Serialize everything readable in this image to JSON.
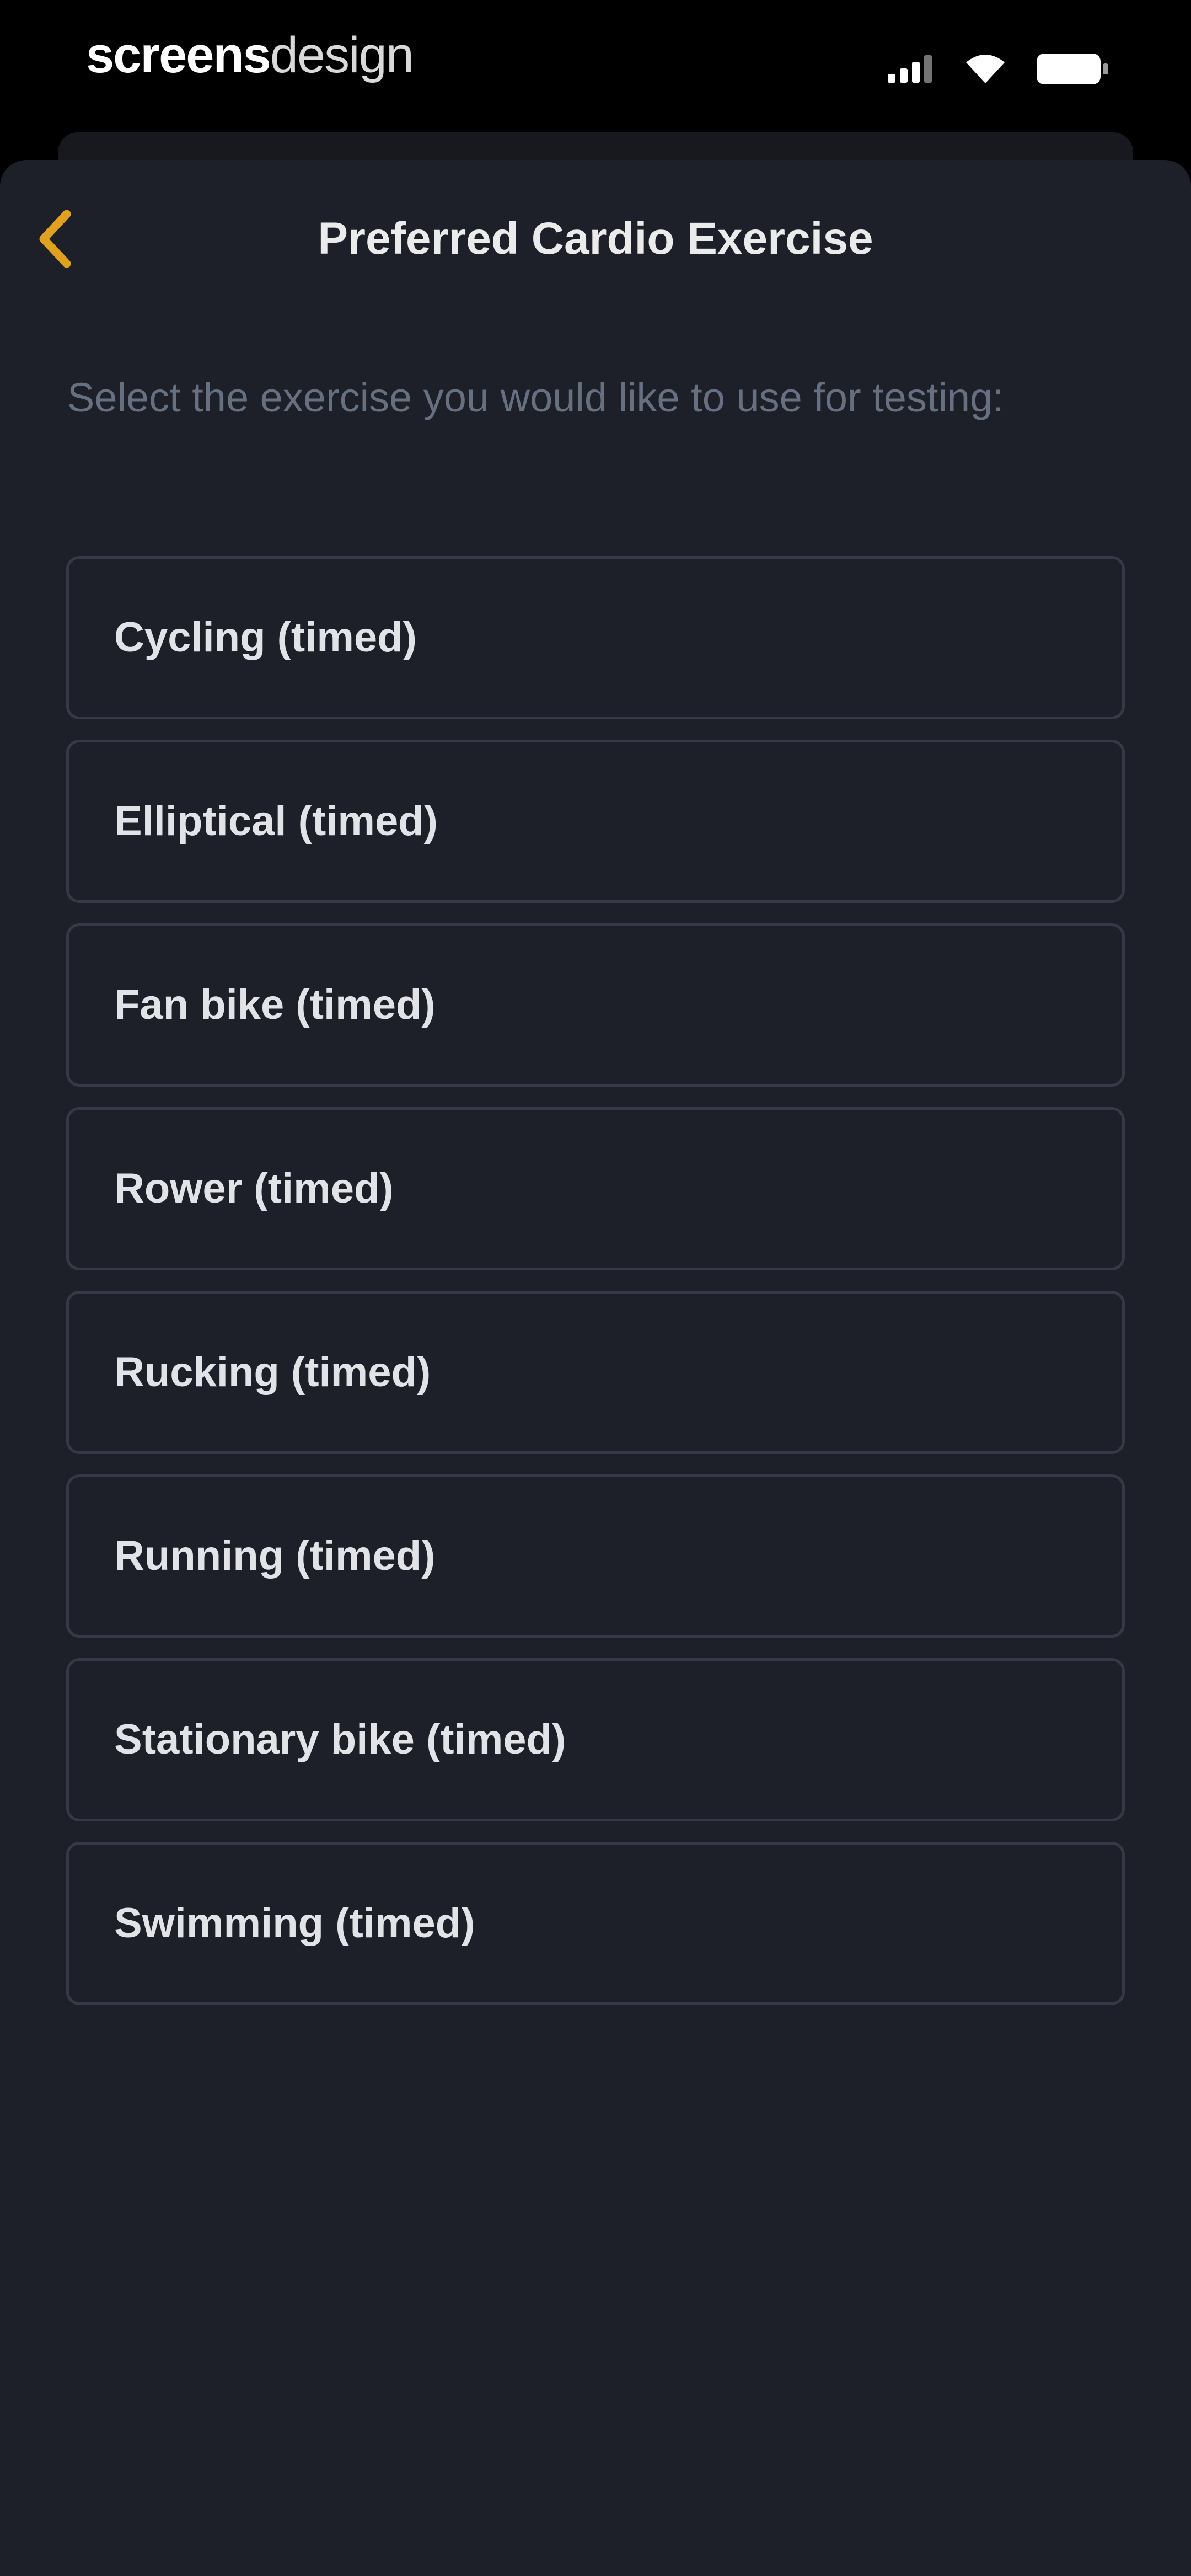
{
  "status_bar": {
    "brand_bold": "screens",
    "brand_light": "design",
    "icons": [
      "signal-icon",
      "wifi-icon",
      "battery-icon"
    ]
  },
  "header": {
    "back_icon": "chevron-left-icon",
    "title": "Preferred Cardio Exercise"
  },
  "subtitle": "Select the exercise you would like to use for testing:",
  "options": [
    {
      "label": "Cycling (timed)"
    },
    {
      "label": "Elliptical (timed)"
    },
    {
      "label": "Fan bike (timed)"
    },
    {
      "label": "Rower (timed)"
    },
    {
      "label": "Rucking (timed)"
    },
    {
      "label": "Running (timed)"
    },
    {
      "label": "Stationary bike (timed)"
    },
    {
      "label": "Swimming (timed)"
    }
  ],
  "colors": {
    "background": "#1d2029",
    "accent": "#e0a020",
    "option_border": "#363a46",
    "subtitle": "#667080",
    "text": "#e2e3e6"
  }
}
